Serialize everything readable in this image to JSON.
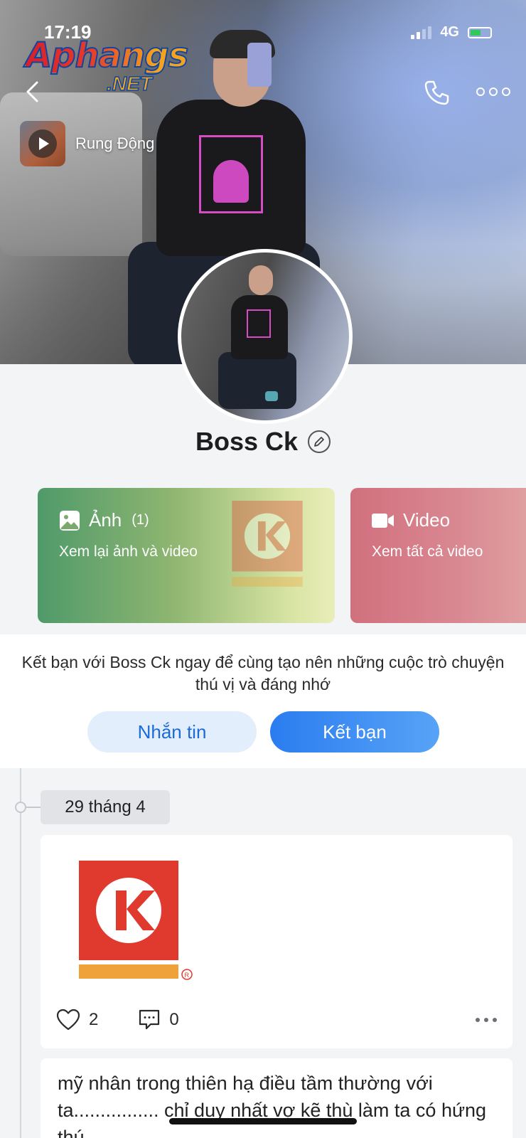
{
  "status_bar": {
    "time": "17:19",
    "network": "4G"
  },
  "watermark": {
    "main": "Aphangs",
    "suffix": ".NET"
  },
  "music": {
    "title": "Rung Động"
  },
  "profile": {
    "name": "Boss Ck"
  },
  "media": {
    "photos": {
      "title": "Ảnh",
      "count": "(1)",
      "subtitle": "Xem lại ảnh và video"
    },
    "videos": {
      "title": "Video",
      "subtitle": "Xem tất cả video"
    }
  },
  "friend_prompt": {
    "text": "Kết bạn với Boss Ck ngay để cùng tạo nên những cuộc trò chuyện thú vị và đáng nhớ",
    "message_label": "Nhắn tin",
    "add_friend_label": "Kết bạn"
  },
  "timeline": {
    "date": "29 tháng 4",
    "post": {
      "likes": "2",
      "comments": "0"
    },
    "next_post_text": "mỹ nhân trong thiên hạ điều tầm thường với ta................ chỉ duy nhất vợ kẽ thù làm ta có hứng thú"
  },
  "colors": {
    "accent": "#2b7cf0",
    "logo_red": "#e03a2f",
    "logo_orange": "#f0a23a"
  },
  "icons": [
    "back-icon",
    "phone-icon",
    "more-icon",
    "play-icon",
    "edit-icon",
    "image-icon",
    "video-camera-icon",
    "heart-icon",
    "comment-icon"
  ]
}
